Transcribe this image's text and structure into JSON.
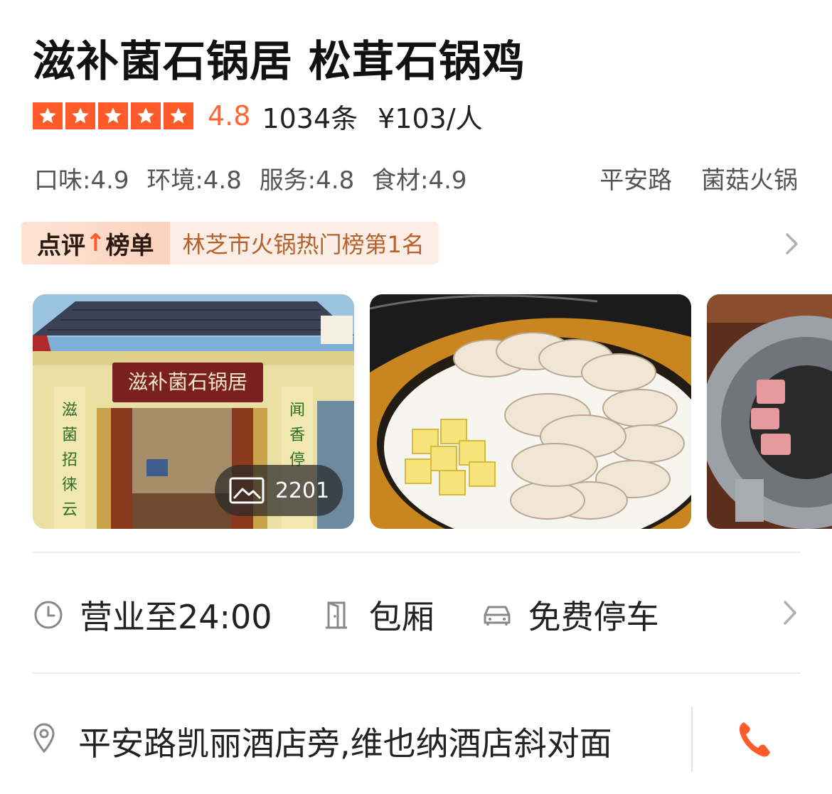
{
  "shop": {
    "name": "滋补菌石锅居 松茸石锅鸡",
    "score": "4.8",
    "review_count": "1034条",
    "price": "¥103/人",
    "star_rating": 5,
    "subscores": [
      "口味:4.9",
      "环境:4.8",
      "服务:4.8",
      "食材:4.9"
    ],
    "tags": [
      "平安路",
      "菌菇火锅"
    ]
  },
  "ranking": {
    "badge_prefix": "点评",
    "badge_suffix": "榜单",
    "text": "林芝市火锅热门榜第1名"
  },
  "gallery": {
    "photo_count": "2201",
    "storefront_sign": "滋补菌石锅居"
  },
  "info": {
    "hours": "营业至24:00",
    "room": "包厢",
    "parking": "免费停车"
  },
  "address": {
    "text": "平安路凯丽酒店旁,维也纳酒店斜对面"
  },
  "icons": {
    "stars": "star-icon",
    "chevron": "chevron-right-icon",
    "clock": "clock-icon",
    "room": "door-icon",
    "parking": "car-icon",
    "location": "location-pin-icon",
    "phone": "phone-icon",
    "photos": "image-icon"
  },
  "colors": {
    "accent": "#ff5b2a",
    "score": "#ff6633",
    "rank_text": "#b5612e",
    "rank_bg": "#fdeee5"
  }
}
